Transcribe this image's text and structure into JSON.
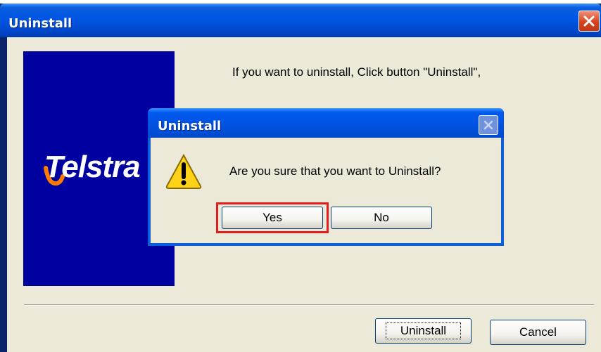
{
  "main_window": {
    "title": "Uninstall",
    "logo_text": "Telstra",
    "instruction": "If you want to uninstall, Click button  \"Uninstall\",",
    "buttons": {
      "uninstall": "Uninstall",
      "cancel": "Cancel"
    }
  },
  "confirm_dialog": {
    "title": "Uninstall",
    "message": "Are you sure that you want to Uninstall?",
    "buttons": {
      "yes": "Yes",
      "no": "No"
    }
  },
  "colors": {
    "titlebar": "#0054e3",
    "close": "#d8421d",
    "logo_background": "#0000a0",
    "highlight": "#e21d1d",
    "dialog_background": "#ece9d8"
  },
  "icons": [
    "close-icon",
    "warning-icon",
    "telstra-logo-icon"
  ]
}
